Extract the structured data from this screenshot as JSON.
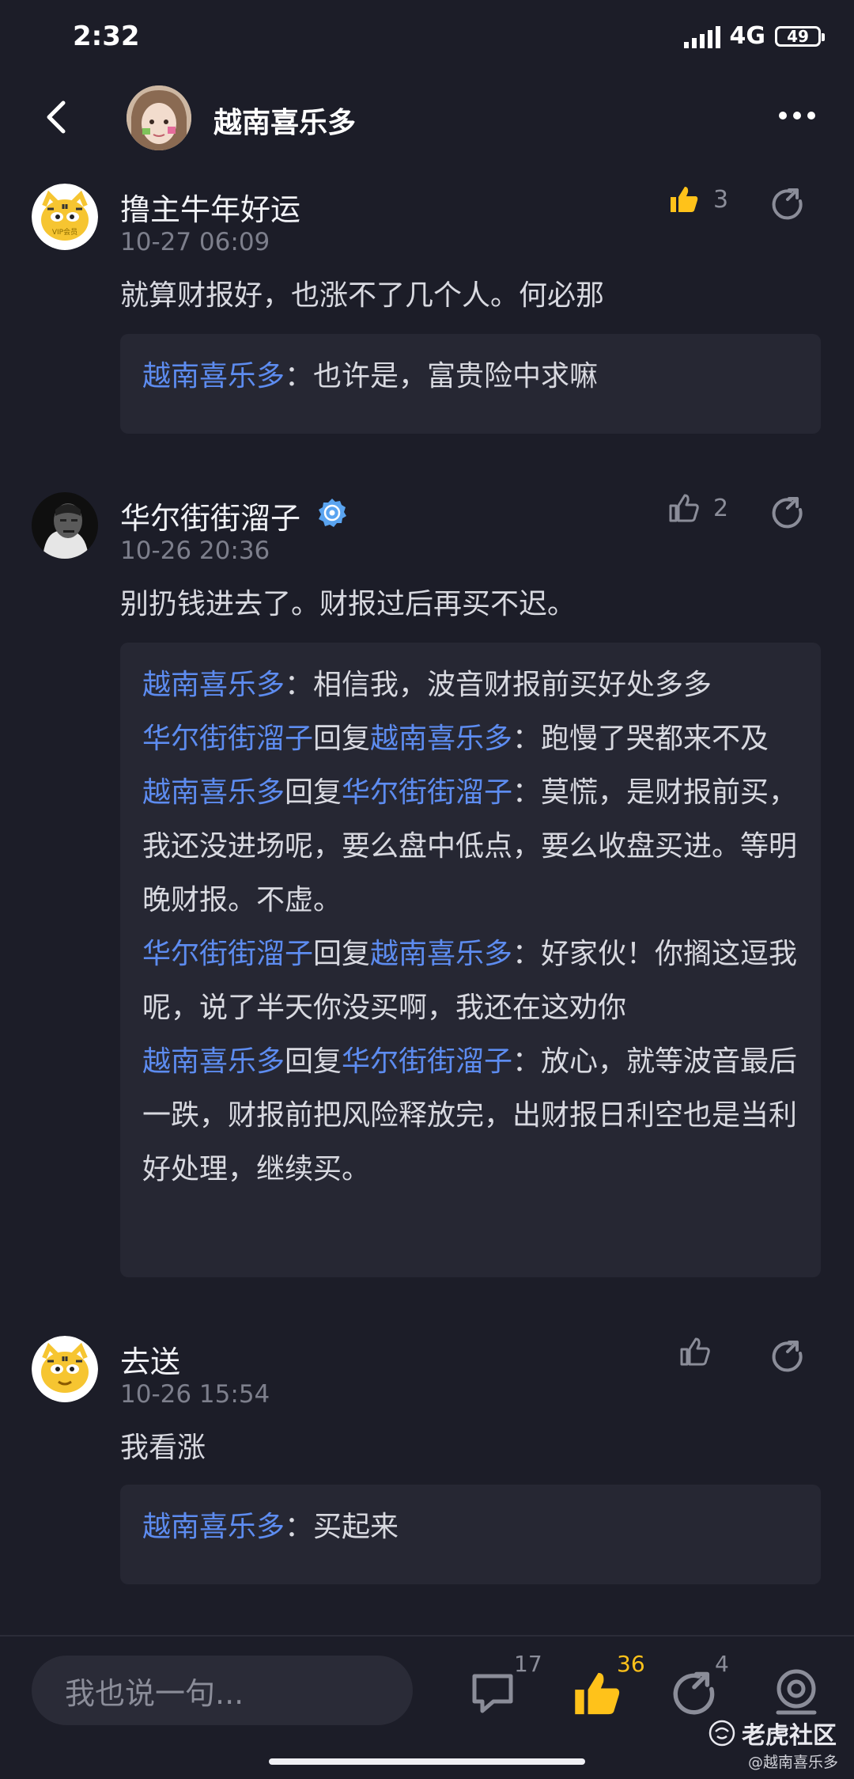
{
  "status_bar": {
    "time": "2:32",
    "network": "4G",
    "battery": "49"
  },
  "header": {
    "title": "越南喜乐多"
  },
  "comments": [
    {
      "name": "撸主牛年好运",
      "time": "10-27 06:09",
      "content": "就算财报好，也涨不了几个人。何必那",
      "likes": "3",
      "liked": true,
      "replies": [
        {
          "from": "越南喜乐多",
          "text": "：也许是，富贵险中求嘛"
        }
      ]
    },
    {
      "name": "华尔街街溜子",
      "time": "10-26 20:36",
      "content": "别扔钱进去了。财报过后再买不迟。",
      "likes": "2",
      "liked": false,
      "replies": [
        {
          "from": "越南喜乐多",
          "text": "：相信我，波音财报前买好处多多"
        },
        {
          "from": "华尔街街溜子",
          "reply_word": "回复",
          "to": "越南喜乐多",
          "text": "：跑慢了哭都来不及"
        },
        {
          "from": "越南喜乐多",
          "reply_word": "回复",
          "to": "华尔街街溜子",
          "text": "：莫慌，是财报前买，我还没进场呢，要么盘中低点，要么收盘买进。等明晚财报。不虚。"
        },
        {
          "from": "华尔街街溜子",
          "reply_word": "回复",
          "to": "越南喜乐多",
          "text": "：好家伙！你搁这逗我呢，说了半天你没买啊，我还在这劝你"
        },
        {
          "from": "越南喜乐多",
          "reply_word": "回复",
          "to": "华尔街街溜子",
          "text": "：放心，就等波音最后一跌，财报前把风险释放完，出财报日利空也是当利好处理，继续买。"
        }
      ]
    },
    {
      "name": "去送",
      "time": "10-26 15:54",
      "content": "我看涨",
      "likes": "",
      "liked": false,
      "replies": [
        {
          "from": "越南喜乐多",
          "text": "：买起来"
        }
      ]
    }
  ],
  "bottom_bar": {
    "input_placeholder": "我也说一句...",
    "comment_count": "17",
    "like_count": "36",
    "share_count": "4"
  },
  "watermark": {
    "brand": "老虎社区",
    "handle": "@越南喜乐多"
  },
  "colors": {
    "background": "#1c1d28",
    "reply_box": "#262733",
    "username_link": "#5d8cf0",
    "liked": "#ffc21a"
  },
  "icons": [
    "back-arrow-icon",
    "more-icon",
    "thumbs-up-icon",
    "share-icon",
    "verified-badge-icon",
    "comment-icon",
    "camera-icon",
    "tiger-logo-icon"
  ]
}
